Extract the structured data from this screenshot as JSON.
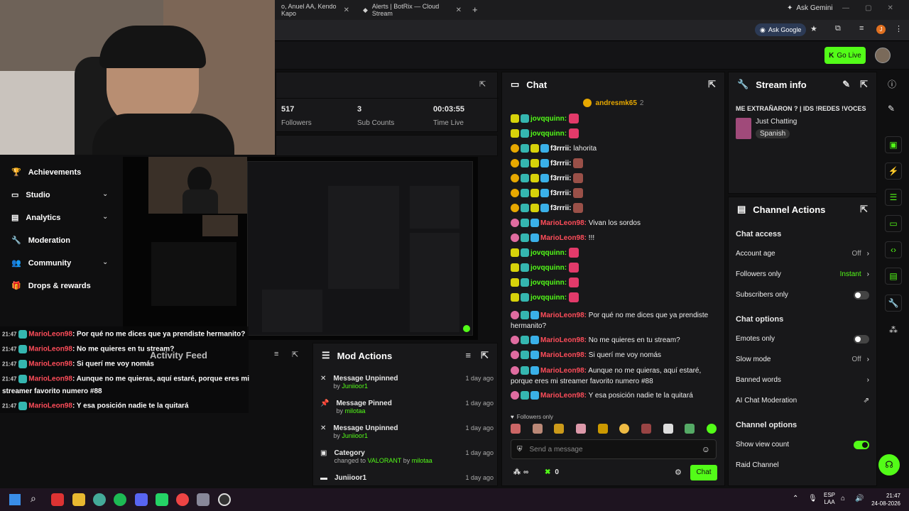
{
  "browser": {
    "tabs": [
      {
        "label": "o, Anuel AA, Kendo Kapo"
      },
      {
        "label": "Alerts | BotRix — Cloud Stream"
      }
    ],
    "ask_gemini": "Ask Gemini",
    "ask_google": "Ask Google",
    "profile_initial": "J"
  },
  "header": {
    "go_live": "Go Live"
  },
  "stats": {
    "followers_value": "517",
    "followers_label": "Followers",
    "subs_value": "3",
    "subs_label": "Sub Counts",
    "time_value": "00:03:55",
    "time_label": "Time Live"
  },
  "nav": {
    "items": [
      {
        "label": "Achievements",
        "icon": "trophy-icon"
      },
      {
        "label": "Studio",
        "icon": "studio-icon"
      },
      {
        "label": "Analytics",
        "icon": "analytics-icon"
      },
      {
        "label": "Moderation",
        "icon": "wrench-icon"
      },
      {
        "label": "Community",
        "icon": "community-icon"
      },
      {
        "label": "Drops & rewards",
        "icon": "gift-icon"
      }
    ]
  },
  "overlay_chat": [
    {
      "time": "21:47",
      "user": "MarioLeon98",
      "text": ": Por qué no me dices que ya prendiste hermanito?"
    },
    {
      "time": "21:47",
      "user": "MarioLeon98",
      "text": ": No me quieres en tu stream?"
    },
    {
      "time": "21:47",
      "user": "MarioLeon98",
      "text": ": Si querí me voy nomás"
    },
    {
      "time": "21:47",
      "user": "MarioLeon98",
      "text": ": Aunque no me quieras, aquí estaré, porque eres mi"
    },
    {
      "time": "",
      "user": "",
      "text": "streamer favorito numero #88"
    },
    {
      "time": "21:47",
      "user": "MarioLeon98",
      "text": ": Y esa posición nadie te la quitará"
    }
  ],
  "activity": {
    "title": "Activity Feed"
  },
  "mod_actions": {
    "title": "Mod Actions",
    "items": [
      {
        "action": "Message Unpinned",
        "by_prefix": "by",
        "by": "Juniioor1",
        "when": "1 day ago",
        "icon": "unpin-icon"
      },
      {
        "action": "Message Pinned",
        "by_prefix": "by",
        "by": "milotaa",
        "when": "1 day ago",
        "icon": "pin-icon"
      },
      {
        "action": "Message Unpinned",
        "by_prefix": "by",
        "by": "Juniioor1",
        "when": "1 day ago",
        "icon": "unpin-icon"
      },
      {
        "action": "Category",
        "by_prefix": "changed to",
        "highlight": "VALORANT",
        "by_mid": "by",
        "by": "milotaa",
        "when": "1 day ago",
        "icon": "category-icon"
      },
      {
        "action": "Juniioor1",
        "by_prefix": "",
        "by": "",
        "when": "1 day ago",
        "icon": "user-icon"
      }
    ]
  },
  "chat": {
    "title": "Chat",
    "pinned_user": "andresmk65",
    "pinned_count": "2",
    "messages": [
      {
        "user": "jovqquinn:",
        "color": "#53fc18",
        "text": "",
        "emote": true,
        "badges": [
          "b-y",
          "b-sub"
        ]
      },
      {
        "user": "jovqquinn:",
        "color": "#53fc18",
        "text": "",
        "emote": true,
        "badges": [
          "b-y",
          "b-sub"
        ]
      },
      {
        "user": "f3rrrii:",
        "color": "#ffffff",
        "text": " lahorita",
        "emote": false,
        "badges": [
          "b-gold",
          "b-sub",
          "b-y",
          "b-blue"
        ]
      },
      {
        "user": "f3rrrii:",
        "color": "#ffffff",
        "text": "",
        "emote": true,
        "badges": [
          "b-gold",
          "b-sub",
          "b-y",
          "b-blue"
        ]
      },
      {
        "user": "f3rrrii:",
        "color": "#ffffff",
        "text": "",
        "emote": true,
        "badges": [
          "b-gold",
          "b-sub",
          "b-y",
          "b-blue"
        ]
      },
      {
        "user": "f3rrrii:",
        "color": "#ffffff",
        "text": "",
        "emote": true,
        "badges": [
          "b-gold",
          "b-sub",
          "b-y",
          "b-blue"
        ]
      },
      {
        "user": "f3rrrii:",
        "color": "#ffffff",
        "text": "",
        "emote": true,
        "badges": [
          "b-gold",
          "b-sub",
          "b-y",
          "b-blue"
        ]
      },
      {
        "user": "MarioLeon98:",
        "color": "#ff4d5a",
        "text": " Vivan los sordos",
        "emote": false,
        "badges": [
          "b-p",
          "b-sub",
          "b-blue"
        ]
      },
      {
        "user": "MarioLeon98:",
        "color": "#ff4d5a",
        "text": " !!!",
        "emote": false,
        "badges": [
          "b-p",
          "b-sub",
          "b-blue"
        ]
      },
      {
        "user": "jovqquinn:",
        "color": "#53fc18",
        "text": "",
        "emote": true,
        "badges": [
          "b-y",
          "b-sub"
        ]
      },
      {
        "user": "jovqquinn:",
        "color": "#53fc18",
        "text": "",
        "emote": true,
        "badges": [
          "b-y",
          "b-sub"
        ]
      },
      {
        "user": "jovqquinn:",
        "color": "#53fc18",
        "text": "",
        "emote": true,
        "badges": [
          "b-y",
          "b-sub"
        ]
      },
      {
        "user": "jovqquinn:",
        "color": "#53fc18",
        "text": "",
        "emote": true,
        "badges": [
          "b-y",
          "b-sub"
        ]
      },
      {
        "user": "MarioLeon98:",
        "color": "#ff4d5a",
        "text": " Por qué no me dices que ya prendiste hermanito?",
        "emote": false,
        "badges": [
          "b-p",
          "b-sub",
          "b-blue"
        ]
      },
      {
        "user": "MarioLeon98:",
        "color": "#ff4d5a",
        "text": " No me quieres en tu stream?",
        "emote": false,
        "badges": [
          "b-p",
          "b-sub",
          "b-blue"
        ]
      },
      {
        "user": "MarioLeon98:",
        "color": "#ff4d5a",
        "text": " Si querí me voy nomás",
        "emote": false,
        "badges": [
          "b-p",
          "b-sub",
          "b-blue"
        ]
      },
      {
        "user": "MarioLeon98:",
        "color": "#ff4d5a",
        "text": " Aunque no me quieras, aquí estaré, porque eres mi streamer favorito numero #88",
        "emote": false,
        "badges": [
          "b-p",
          "b-sub",
          "b-blue"
        ]
      },
      {
        "user": "MarioLeon98:",
        "color": "#ff4d5a",
        "text": " Y esa posición nadie te la quitará",
        "emote": false,
        "badges": [
          "b-p",
          "b-sub",
          "b-blue"
        ]
      }
    ],
    "followers_only": "Followers only",
    "placeholder": "Send a message",
    "viewers": "∞",
    "points": "0",
    "send": "Chat"
  },
  "stream_info": {
    "title": "Stream info",
    "stream_title": "ME EXTRAÑARON ? | IDS !REDES !VOCES",
    "category": "Just Chatting",
    "language": "Spanish"
  },
  "channel_actions": {
    "title": "Channel Actions",
    "chat_access": "Chat access",
    "account_age": "Account age",
    "account_age_value": "Off",
    "followers_only": "Followers only",
    "followers_only_value": "Instant",
    "subscribers_only": "Subscribers only",
    "chat_options": "Chat options",
    "emotes_only": "Emotes only",
    "slow_mode": "Slow mode",
    "slow_mode_value": "Off",
    "banned_words": "Banned words",
    "ai_mod": "AI Chat Moderation",
    "channel_options": "Channel options",
    "show_view_count": "Show view count",
    "raid_channel": "Raid Channel"
  },
  "colors": {
    "accent": "#53fc18",
    "red_user": "#ff4d5a"
  },
  "taskbar": {
    "lang1": "ESP",
    "lang2": "LAA",
    "time": "21:47",
    "date": "24-08-2026"
  }
}
